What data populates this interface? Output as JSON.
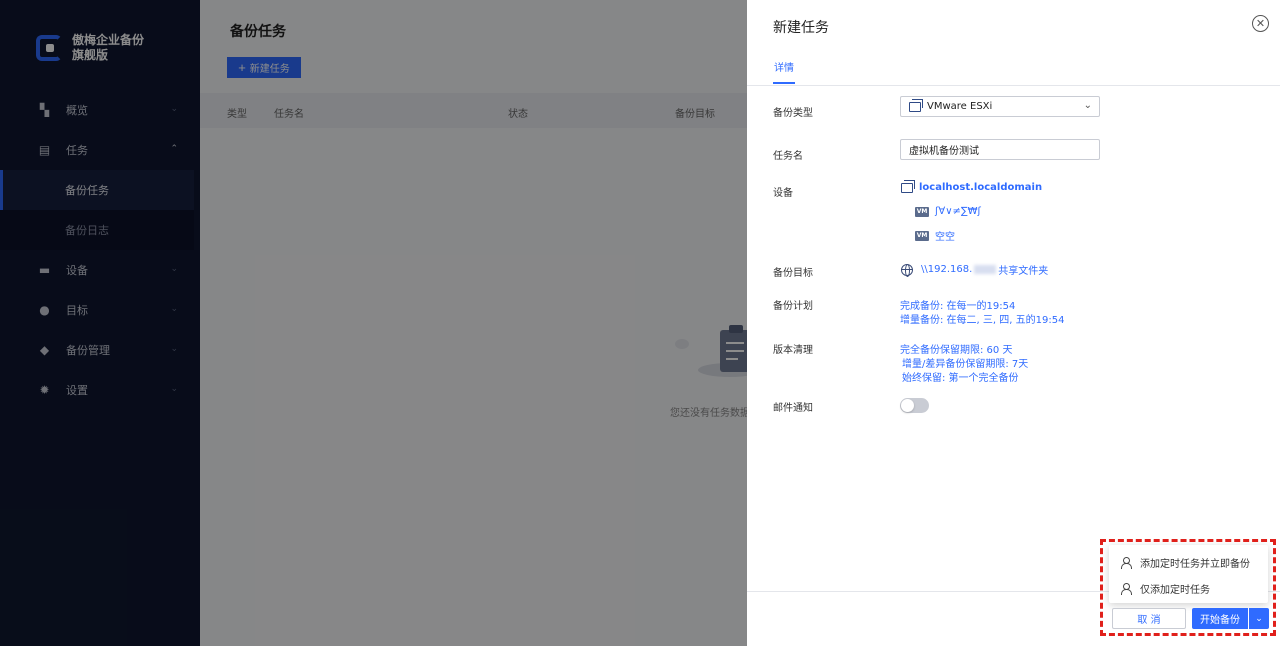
{
  "app": {
    "name": "傲梅企业备份旗舰版"
  },
  "sidebar": {
    "items": [
      {
        "label": "概览",
        "icon": "dashboard-icon"
      },
      {
        "label": "任务",
        "icon": "clipboard-icon",
        "children": [
          "备份任务",
          "备份日志"
        ]
      },
      {
        "label": "设备",
        "icon": "monitor-icon"
      },
      {
        "label": "目标",
        "icon": "location-pin-icon"
      },
      {
        "label": "备份管理",
        "icon": "layers-icon"
      },
      {
        "label": "设置",
        "icon": "gear-icon"
      }
    ]
  },
  "main": {
    "title": "备份任务",
    "new_button": "新建任务",
    "columns": [
      "类型",
      "任务名",
      "状态",
      "备份目标"
    ],
    "empty_text": "您还没有任务数据"
  },
  "panel": {
    "title": "新建任务",
    "tab": "详情",
    "backup_type_label": "备份类型",
    "backup_type_value": "VMware ESXi",
    "task_name_label": "任务名",
    "task_name_value": "虚拟机备份测试",
    "device_label": "设备",
    "device_host": "localhost.localdomain",
    "vm_badge": "VM",
    "vms": [
      "ʃ∀∨≠∑₩ʃ",
      "空空"
    ],
    "target_label": "备份目标",
    "target_prefix": "\\\\192.168.",
    "target_suffix": "共享文件夹",
    "schedule_label": "备份计划",
    "schedule_lines": [
      "完成备份: 在每一的19:54",
      "增量备份: 在每二, 三, 四, 五的19:54"
    ],
    "cleanup_label": "版本清理",
    "cleanup_lines": [
      "完全备份保留期限: 60 天",
      "增量/差异备份保留期限: 7天",
      "始终保留: 第一个完全备份"
    ],
    "email_label": "邮件通知",
    "email_enabled": false
  },
  "dropdown": {
    "items": [
      "添加定时任务并立即备份",
      "仅添加定时任务"
    ]
  },
  "footer": {
    "cancel": "取 消",
    "start": "开始备份"
  },
  "colors": {
    "accent": "#2f6bff",
    "sidebar_bg": "#0f1730",
    "highlight": "#e0201b"
  }
}
